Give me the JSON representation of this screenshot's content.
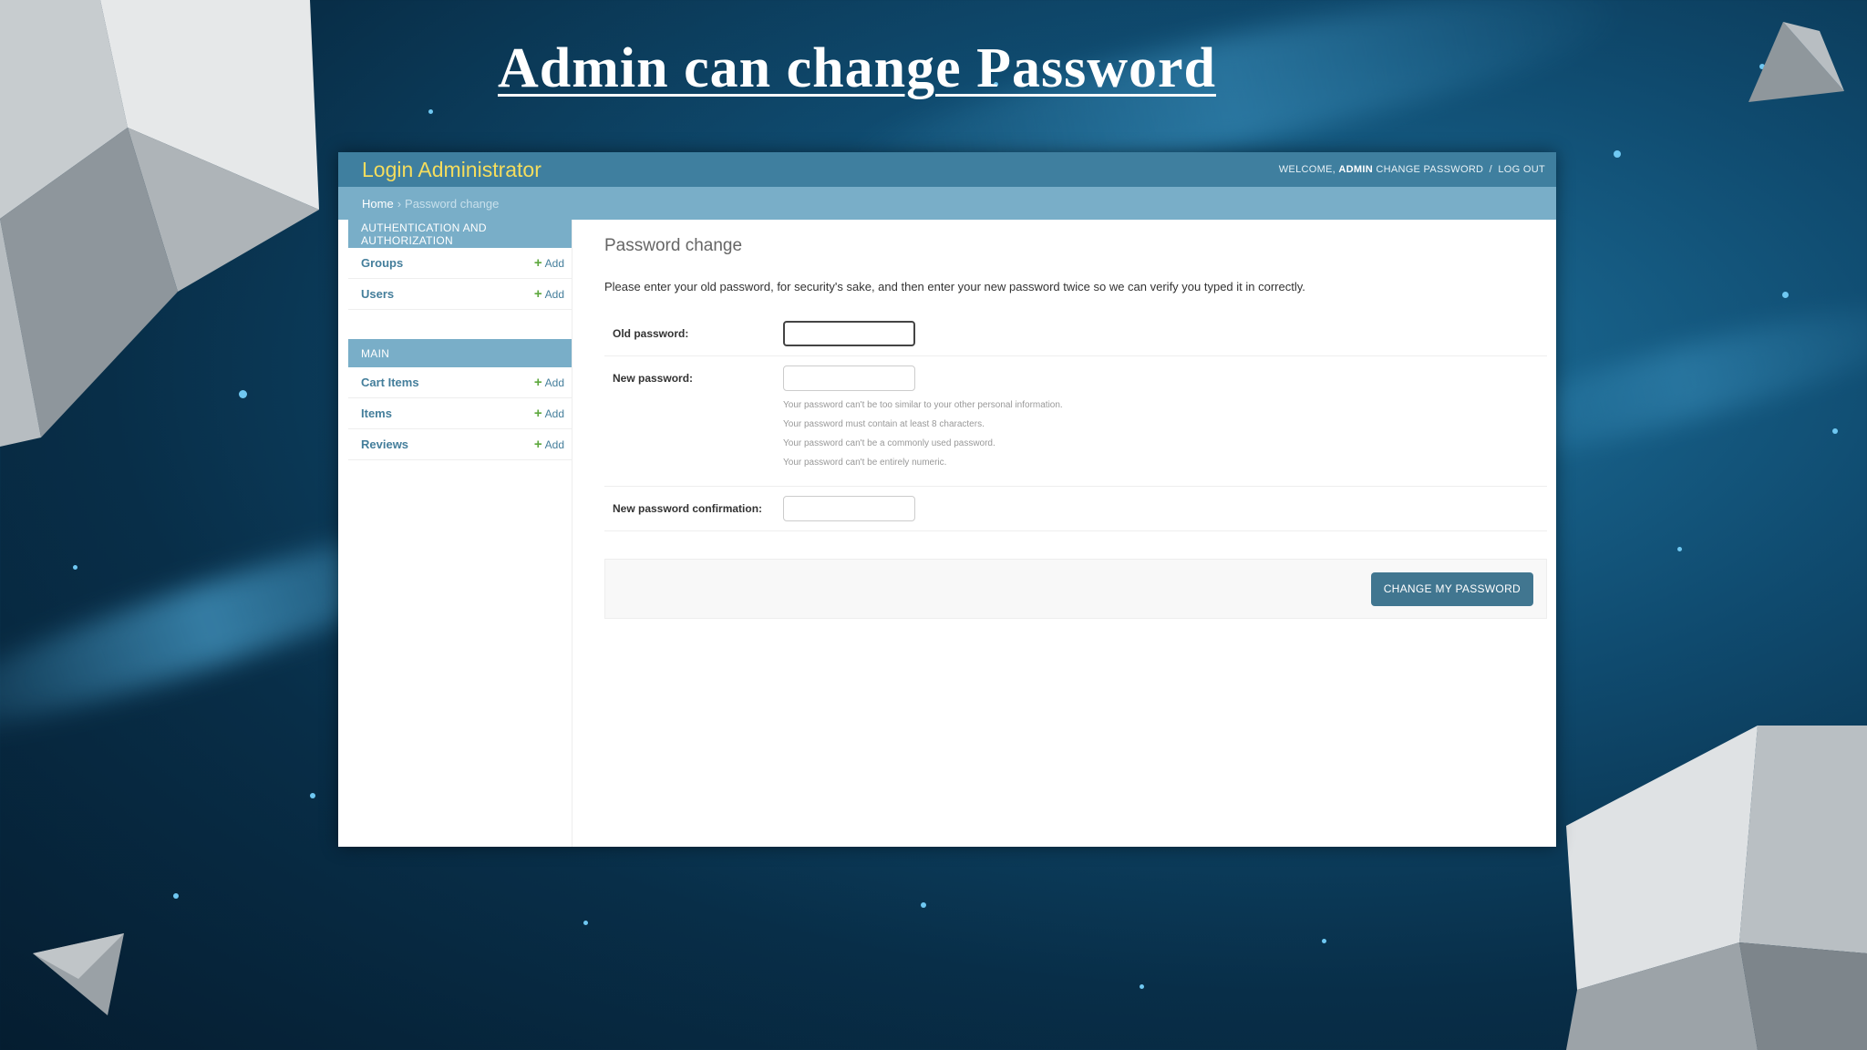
{
  "slide": {
    "title": "Admin can change Password"
  },
  "header": {
    "site_name": "Login Administrator",
    "welcome": "WELCOME,",
    "username": "ADMIN",
    "change_password": "CHANGE PASSWORD",
    "separator": "/",
    "logout": "LOG OUT"
  },
  "breadcrumbs": {
    "home": "Home",
    "separator": "›",
    "current": "Password change"
  },
  "sidebar": {
    "modules": [
      {
        "caption": "AUTHENTICATION AND AUTHORIZATION",
        "rows": [
          {
            "name": "Groups",
            "add": "Add"
          },
          {
            "name": "Users",
            "add": "Add"
          }
        ]
      },
      {
        "caption": "MAIN",
        "rows": [
          {
            "name": "Cart Items",
            "add": "Add"
          },
          {
            "name": "Items",
            "add": "Add"
          },
          {
            "name": "Reviews",
            "add": "Add"
          }
        ]
      }
    ]
  },
  "content": {
    "title": "Password change",
    "intro": "Please enter your old password, for security's sake, and then enter your new password twice so we can verify you typed it in correctly.",
    "old_password_label": "Old password:",
    "new_password_label": "New password:",
    "confirm_label": "New password confirmation:",
    "help": [
      "Your password can't be too similar to your other personal information.",
      "Your password must contain at least 8 characters.",
      "Your password can't be a commonly used password.",
      "Your password can't be entirely numeric."
    ],
    "submit_label": "CHANGE MY PASSWORD"
  },
  "colors": {
    "header_bg": "#3f7f9f",
    "site_name": "#f5dd5d",
    "breadcrumb_bg": "#79aec8",
    "link": "#447e9b",
    "button": "#417690"
  }
}
